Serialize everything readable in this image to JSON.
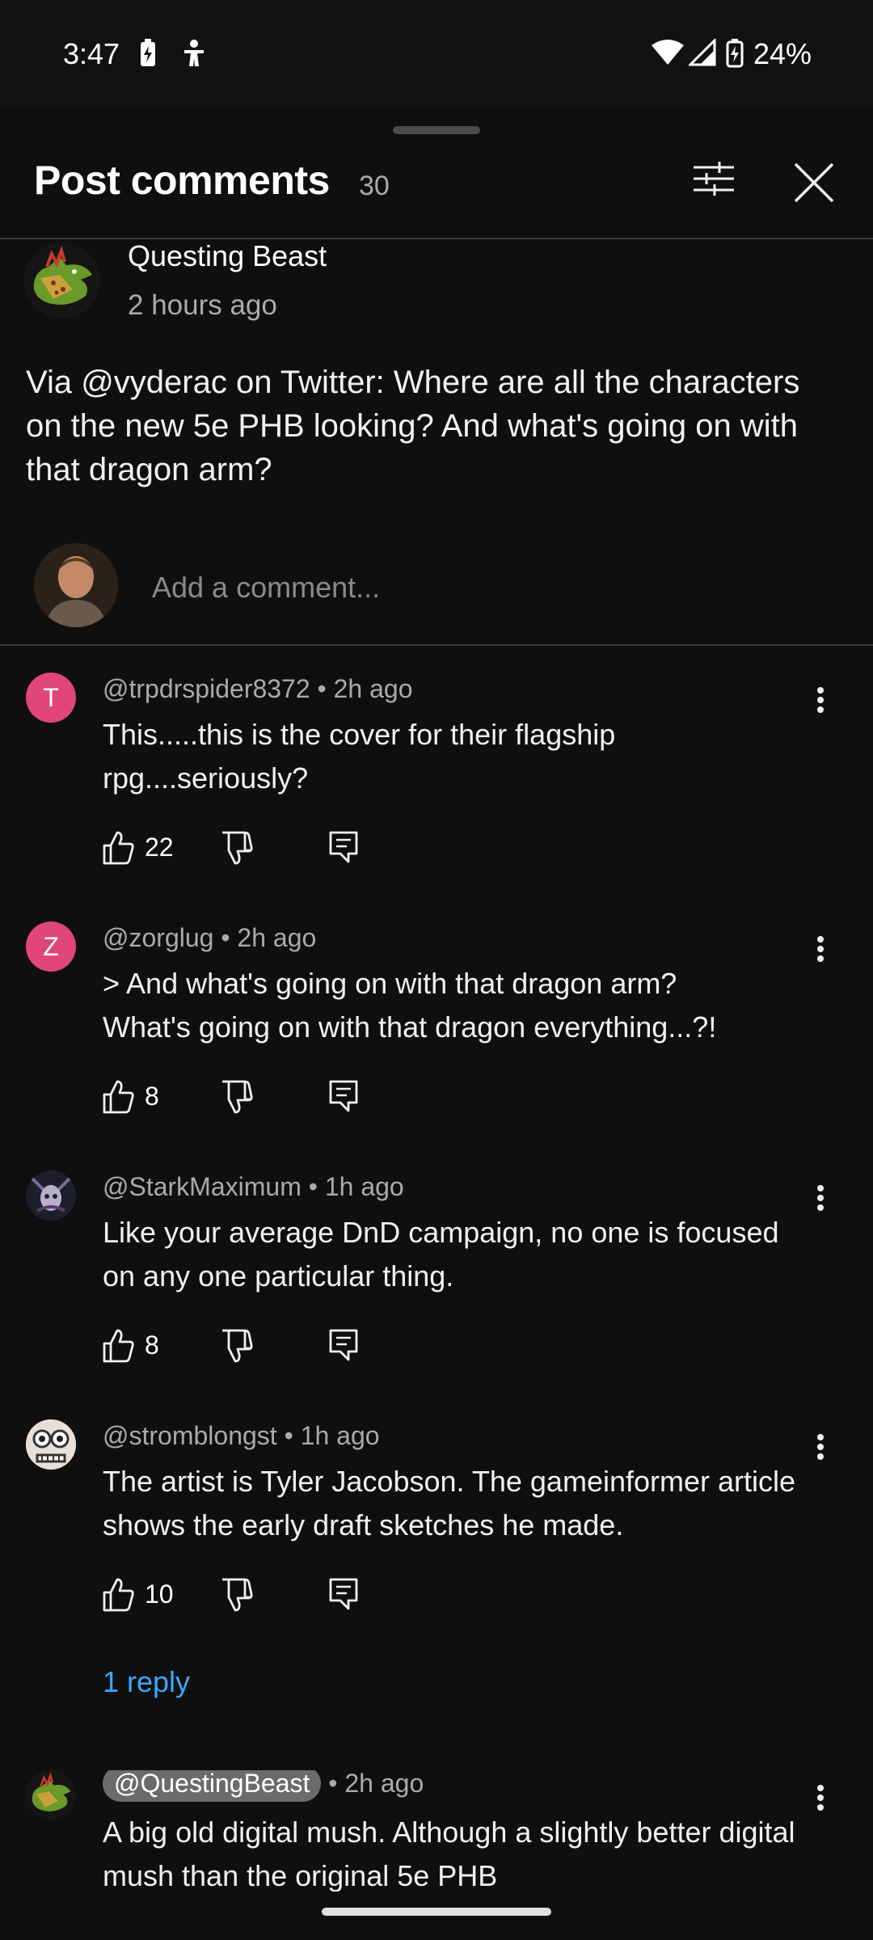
{
  "status_bar": {
    "time": "3:47",
    "battery": "24%",
    "icons": [
      "battery-saver-icon",
      "accessibility-icon",
      "wifi-icon",
      "cellular-icon",
      "battery-icon"
    ]
  },
  "sheet": {
    "title": "Post comments",
    "count": "30"
  },
  "post": {
    "author": "Questing Beast",
    "time": "2 hours ago",
    "body": "Via @vyderac on Twitter: Where are all the characters on the new 5e PHB looking? And what's going on with that dragon arm?"
  },
  "composer": {
    "placeholder": "Add a comment..."
  },
  "comments": [
    {
      "initial": "T",
      "avatar_color": "#e0457b",
      "handle": "@trpdrspider8372",
      "time": "2h ago",
      "text": "This.....this is the cover for their flagship rpg....seriously?",
      "likes": "22"
    },
    {
      "initial": "Z",
      "avatar_color": "#e0457b",
      "handle": "@zorglug",
      "time": "2h ago",
      "text_line1": "> And what's going on with that dragon arm?",
      "text_line2": "What's going on with that dragon everything...?!",
      "likes": "8"
    },
    {
      "handle": "@StarkMaximum",
      "time": "1h ago",
      "text": "Like your average DnD campaign, no one is focused on any one particular thing.",
      "likes": "8"
    },
    {
      "handle": "@stromblongst",
      "time": "1h ago",
      "text": "The artist is Tyler Jacobson. The gameinformer article shows the early draft sketches he made.",
      "likes": "10",
      "replies": "1 reply"
    },
    {
      "handle": "@QuestingBeast",
      "time": "2h ago",
      "text": "A big old digital mush. Although a slightly better digital mush than the original 5e PHB"
    }
  ],
  "separator": "•"
}
